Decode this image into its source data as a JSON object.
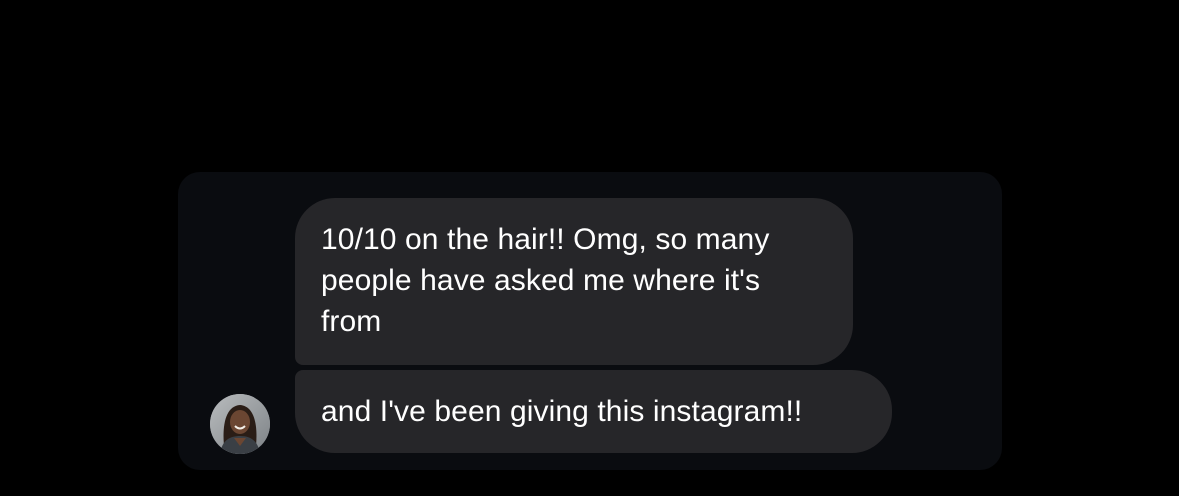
{
  "conversation": {
    "messages": [
      {
        "text": "10/10 on the hair!! Omg, so many people have asked me where it's from"
      },
      {
        "text": "and I've been giving this instagram!!"
      }
    ],
    "sender": {
      "avatar_icon": "user-avatar-photo"
    }
  },
  "colors": {
    "background": "#000000",
    "panel": "#0a0c10",
    "bubble": "#262629",
    "text": "#ffffff"
  }
}
